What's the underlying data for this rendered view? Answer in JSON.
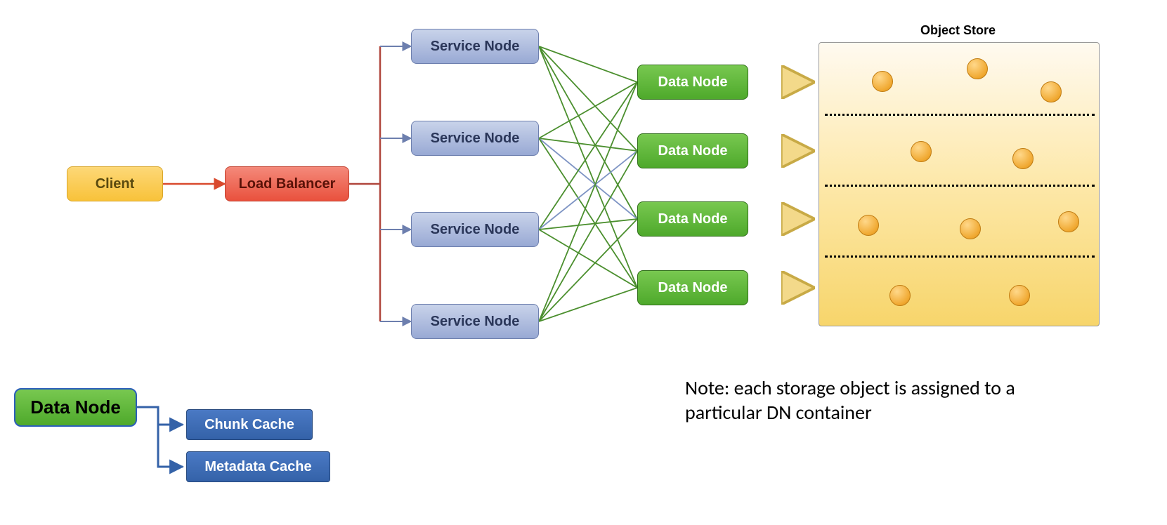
{
  "nodes": {
    "client": "Client",
    "lb": "Load Balancer",
    "sn1": "Service Node",
    "sn2": "Service Node",
    "sn3": "Service Node",
    "sn4": "Service Node",
    "dn1": "Data Node",
    "dn2": "Data Node",
    "dn3": "Data Node",
    "dn4": "Data Node"
  },
  "store_title": "Object Store",
  "note": "Note: each storage object is assigned to a particular DN container",
  "legend": {
    "dn": "Data Node",
    "chunk": "Chunk Cache",
    "meta": "Metadata Cache"
  }
}
